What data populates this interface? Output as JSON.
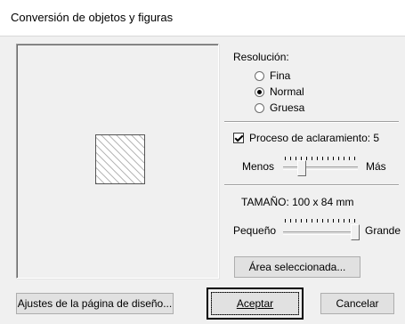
{
  "window": {
    "title": "Conversión de objetos y figuras"
  },
  "resolution": {
    "label": "Resolución:",
    "options": [
      {
        "label": "Fina",
        "selected": false
      },
      {
        "label": "Normal",
        "selected": true
      },
      {
        "label": "Gruesa",
        "selected": false
      }
    ]
  },
  "clarify": {
    "checkbox_label": "Proceso de aclaramiento: 5",
    "checked": true,
    "value": 5,
    "slider_min_label": "Menos",
    "slider_max_label": "Más"
  },
  "size": {
    "label": "TAMAÑO:  100 x 84 mm",
    "slider_min_label": "Pequeño",
    "slider_max_label": "Grande",
    "slider_level": 1.0
  },
  "buttons": {
    "selected_area": "Área seleccionada...",
    "page_settings": "Ajustes de la página de diseño...",
    "accept": "Aceptar",
    "cancel": "Cancelar"
  }
}
